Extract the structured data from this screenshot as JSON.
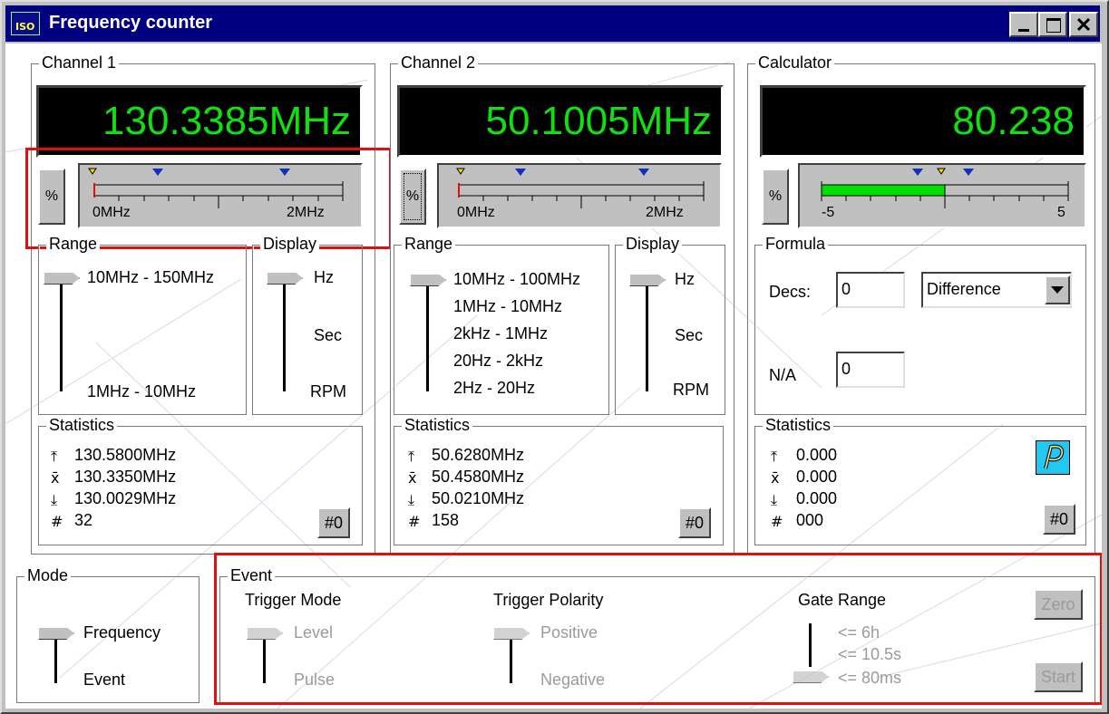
{
  "window": {
    "title": "Frequency counter",
    "icon_label": "ISO"
  },
  "channel1": {
    "title": "Channel 1",
    "reading": "130.3385MHz",
    "pct_button": "%",
    "gauge": {
      "min_label": "0MHz",
      "max_label": "2MHz"
    },
    "range": {
      "title": "Range",
      "top": "10MHz - 150MHz",
      "bottom": "1MHz - 10MHz"
    },
    "display": {
      "title": "Display",
      "items": [
        "Hz",
        "Sec",
        "RPM"
      ]
    },
    "stats": {
      "title": "Statistics",
      "max": "130.5800MHz",
      "avg": "130.3350MHz",
      "min": "130.0029MHz",
      "count": "32",
      "reset": "#0"
    }
  },
  "channel2": {
    "title": "Channel 2",
    "reading": "50.1005MHz",
    "pct_button": "%",
    "gauge": {
      "min_label": "0MHz",
      "max_label": "2MHz"
    },
    "range": {
      "title": "Range",
      "items": [
        "10MHz - 100MHz",
        "1MHz - 10MHz",
        "2kHz - 1MHz",
        "20Hz - 2kHz",
        "2Hz - 20Hz"
      ]
    },
    "display": {
      "title": "Display",
      "items": [
        "Hz",
        "Sec",
        "RPM"
      ]
    },
    "stats": {
      "title": "Statistics",
      "max": "50.6280MHz",
      "avg": "50.4580MHz",
      "min": "50.0210MHz",
      "count": "158",
      "reset": "#0"
    }
  },
  "calculator": {
    "title": "Calculator",
    "reading": "80.238",
    "pct_button": "%",
    "gauge": {
      "min_label": "-5",
      "max_label": "5"
    },
    "formula": {
      "title": "Formula",
      "decs_label": "Decs:",
      "decs_value": "0",
      "function": "Difference",
      "na_label": "N/A",
      "na_value": "0"
    },
    "stats": {
      "title": "Statistics",
      "max": "0.000",
      "avg": "0.000",
      "min": "0.000",
      "count": "000",
      "reset": "#0"
    }
  },
  "mode": {
    "title": "Mode",
    "items": [
      "Frequency",
      "Event"
    ]
  },
  "event": {
    "title": "Event",
    "trigger_mode": {
      "title": "Trigger Mode",
      "items": [
        "Level",
        "Pulse"
      ]
    },
    "trigger_polarity": {
      "title": "Trigger Polarity",
      "items": [
        "Positive",
        "Negative"
      ]
    },
    "gate_range": {
      "title": "Gate Range",
      "items": [
        "<= 6h",
        "<= 10.5s",
        "<= 80ms"
      ]
    },
    "zero_button": "Zero",
    "start_button": "Start"
  },
  "symbols": {
    "max": "⤒",
    "avg": "x̄",
    "min": "⤓",
    "count": "#"
  },
  "colors": {
    "lcd_text": "#10e010",
    "highlight": "#e01010",
    "titlebar": "#000080",
    "calc_bar": "#00e000"
  }
}
